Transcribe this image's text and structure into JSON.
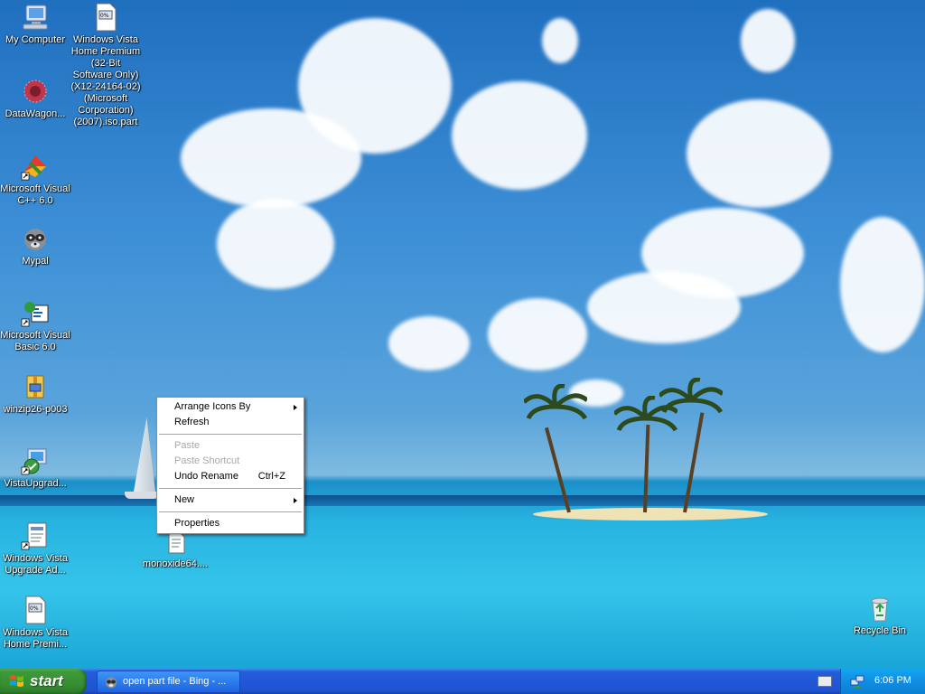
{
  "desktop": {
    "icons": [
      {
        "id": "my-computer",
        "label": "My Computer",
        "icon": "computer-icon"
      },
      {
        "id": "vista-iso-part",
        "label": "Windows Vista Home Premium (32-Bit Software Only)(X12-24164-02)(Microsoft Corporation)(2007).iso.part",
        "icon": "file-icon"
      },
      {
        "id": "datawagon",
        "label": "DataWagon...",
        "icon": "datawagon-icon"
      },
      {
        "id": "msvc",
        "label": "Microsoft Visual C++ 6.0",
        "icon": "visual-cpp-icon"
      },
      {
        "id": "mypal",
        "label": "Mypal",
        "icon": "raccoon-icon"
      },
      {
        "id": "msvb",
        "label": "Microsoft Visual Basic 6.0",
        "icon": "visual-basic-icon"
      },
      {
        "id": "winzip",
        "label": "winzip26-p003",
        "icon": "winzip-icon"
      },
      {
        "id": "vistaupgrade",
        "label": "VistaUpgrad...",
        "icon": "upgrade-advisor-icon"
      },
      {
        "id": "vista-upgrade-ad",
        "label": "Windows Vista Upgrade Ad...",
        "icon": "shortcut-icon"
      },
      {
        "id": "vista-home-premi",
        "label": "Windows Vista Home Premi...",
        "icon": "file-icon"
      },
      {
        "id": "monoxide",
        "label": "monoxide64....",
        "icon": "file-icon"
      },
      {
        "id": "recycle-bin",
        "label": "Recycle Bin",
        "icon": "recycle-bin-icon"
      }
    ]
  },
  "context_menu": {
    "items": [
      {
        "label": "Arrange Icons By",
        "submenu": true,
        "disabled": false
      },
      {
        "label": "Refresh",
        "submenu": false,
        "disabled": false
      },
      {
        "label": "Paste",
        "submenu": false,
        "disabled": true
      },
      {
        "label": "Paste Shortcut",
        "submenu": false,
        "disabled": true
      },
      {
        "label": "Undo Rename",
        "shortcut": "Ctrl+Z",
        "submenu": false,
        "disabled": false
      },
      {
        "label": "New",
        "submenu": true,
        "disabled": false
      },
      {
        "label": "Properties",
        "submenu": false,
        "disabled": false
      }
    ]
  },
  "taskbar": {
    "start_label": "start",
    "tasks": [
      {
        "label": "open part file - Bing - ...",
        "icon": "raccoon-icon"
      }
    ],
    "tray": {
      "time": "6:06 PM"
    }
  },
  "colors": {
    "taskbar": "#245edb",
    "start": "#3c9a38",
    "tray": "#0f8ee3",
    "menu_disabled": "#a8a8a8"
  }
}
